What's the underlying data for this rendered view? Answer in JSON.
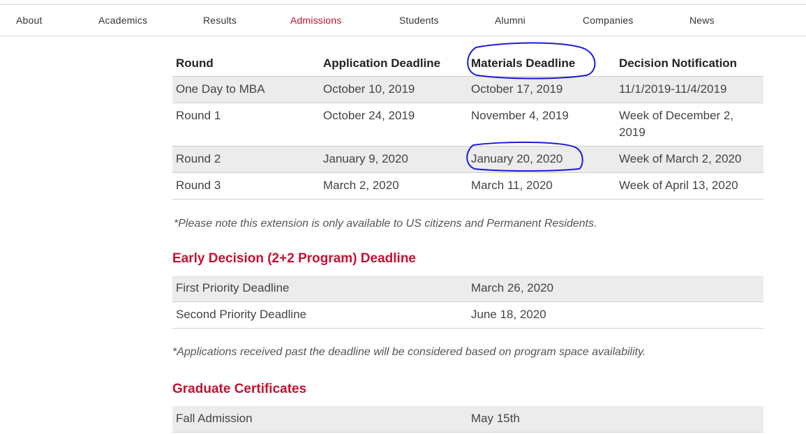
{
  "nav": {
    "items": [
      {
        "label": "About"
      },
      {
        "label": "Academics"
      },
      {
        "label": "Results"
      },
      {
        "label": "Admissions",
        "active": true
      },
      {
        "label": "Students"
      },
      {
        "label": "Alumni"
      },
      {
        "label": "Companies"
      },
      {
        "label": "News"
      }
    ],
    "active_color": "#c41230"
  },
  "deadlines_table": {
    "headers": [
      "Round",
      "Application Deadline",
      "Materials Deadline",
      "Decision Notification"
    ],
    "rows": [
      [
        "One Day to MBA",
        "October 10, 2019",
        "October 17, 2019",
        "11/1/2019-11/4/2019"
      ],
      [
        "Round 1",
        "October 24, 2019",
        "November 4, 2019",
        "Week of December 2, 2019"
      ],
      [
        "Round 2",
        "January 9, 2020",
        "January 20, 2020",
        "Week of March 2, 2020"
      ],
      [
        "Round 3",
        "March 2, 2020",
        "March 11, 2020",
        "Week of April 13, 2020"
      ]
    ]
  },
  "note1": "*Please note this extension is only available to US citizens and Permanent Residents.",
  "early_decision": {
    "title": "Early Decision (2+2 Program) Deadline",
    "rows": [
      [
        "First Priority Deadline",
        "March 26, 2020"
      ],
      [
        "Second Priority Deadline",
        "June 18, 2020"
      ]
    ]
  },
  "note2": "*Applications received past the deadline will be considered based on program space availability.",
  "grad_certs": {
    "title": "Graduate Certificates",
    "rows": [
      [
        "Fall Admission",
        "May 15th"
      ]
    ]
  },
  "colors": {
    "accent": "#c41230",
    "annotation": "#1a1adb",
    "row_shade": "#ececec"
  }
}
